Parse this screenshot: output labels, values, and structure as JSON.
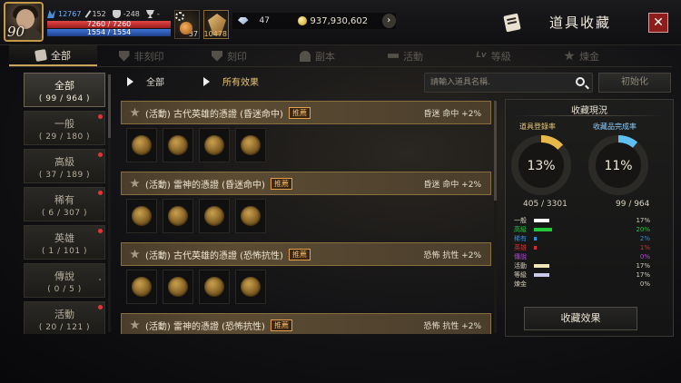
{
  "player": {
    "level": "90",
    "combat_power": "12767",
    "attack": "152",
    "defense": "-248",
    "trophy": "-",
    "hp": "7260 / 7260",
    "mp": "1554 / 1554"
  },
  "quick_slots": [
    {
      "count": "37",
      "icon": "potion-icon"
    },
    {
      "count": "10478",
      "icon": "wing-icon"
    }
  ],
  "currency": {
    "gems": "47",
    "gold": "937,930,602"
  },
  "header": {
    "title": "道具收藏",
    "close_label": "✕"
  },
  "tabs": [
    {
      "label": "全部",
      "icon": "book-icon",
      "active": true
    },
    {
      "label": "非刻印",
      "icon": "shield-icon"
    },
    {
      "label": "刻印",
      "icon": "shield-icon"
    },
    {
      "label": "副本",
      "icon": "magnet-icon"
    },
    {
      "label": "活動",
      "icon": "dumbbell-icon"
    },
    {
      "label": "等級",
      "icon": "lv-icon"
    },
    {
      "label": "煉金",
      "icon": "star-icon"
    }
  ],
  "categories": [
    {
      "name": "全部",
      "count": "( 99 / 964 )",
      "active": true
    },
    {
      "name": "一般",
      "count": "( 29 / 180 )",
      "dot": true
    },
    {
      "name": "高級",
      "count": "( 37 / 189 )",
      "dot": true
    },
    {
      "name": "稀有",
      "count": "( 6 / 307 )",
      "dot": true
    },
    {
      "name": "英雄",
      "count": "( 1 / 101 )",
      "dot": true
    },
    {
      "name": "傳說",
      "count": "( 0 / 5 )"
    },
    {
      "name": "活動",
      "count": "( 20 / 121 )",
      "dot": true
    }
  ],
  "filters": {
    "category": "全部",
    "effect": "所有效果"
  },
  "search": {
    "placeholder": "請輸入道具名稱.",
    "value": ""
  },
  "reset_label": "初始化",
  "sets": [
    {
      "name": "(活動) 古代英雄的憑證 (昏迷命中)",
      "badge": "推薦",
      "effect": "昏迷 命中 +2%",
      "items": 4
    },
    {
      "name": "(活動) 雷神的憑證 (昏迷命中)",
      "badge": "推薦",
      "effect": "昏迷 命中 +2%",
      "items": 4
    },
    {
      "name": "(活動) 古代英雄的憑證 (恐怖抗性)",
      "badge": "推薦",
      "effect": "恐怖 抗性 +2%",
      "items": 4
    },
    {
      "name": "(活動) 雷神的憑證 (恐怖抗性)",
      "badge": "推薦",
      "effect": "恐怖 抗性 +2%",
      "items": 4
    }
  ],
  "status": {
    "title": "收藏現況",
    "registration_label": "道具登錄率",
    "registration_pct": "13%",
    "registration_value": 0.13,
    "registration_count": "405 / 3301",
    "completion_label": "收藏品完成率",
    "completion_pct": "11%",
    "completion_value": 0.11,
    "completion_count": "99 / 964",
    "grades": [
      {
        "name": "一般",
        "pct": "17%",
        "color": "#ffffff",
        "pct_color": "#d4ccbb",
        "value": 0.17
      },
      {
        "name": "高級",
        "pct": "20%",
        "color": "#22c93a",
        "pct_color": "#22c93a",
        "value": 0.2
      },
      {
        "name": "稀有",
        "pct": "2%",
        "color": "#2e8ee0",
        "pct_color": "#2e8ee0",
        "value": 0.02
      },
      {
        "name": "英雄",
        "pct": "1%",
        "color": "#d42f2f",
        "pct_color": "#d42f2f",
        "value": 0.01
      },
      {
        "name": "傳說",
        "pct": "0%",
        "color": "#b04ad6",
        "pct_color": "#b04ad6",
        "value": 0
      },
      {
        "name": "活動",
        "pct": "17%",
        "color": "#efe7b8",
        "pct_color": "#d4ccbb",
        "value": 0.17
      },
      {
        "name": "等級",
        "pct": "17%",
        "color": "#c9c9e6",
        "pct_color": "#d4ccbb",
        "value": 0.17
      },
      {
        "name": "煉金",
        "pct": "0%",
        "color": "#888888",
        "pct_color": "#d4ccbb",
        "value": 0
      }
    ],
    "effect_button": "收藏效果"
  },
  "colors": {
    "accent_gold": "#c9a45c",
    "registration": "#e8b84a",
    "completion": "#5fc0f0",
    "close": "#8c1d1a"
  }
}
